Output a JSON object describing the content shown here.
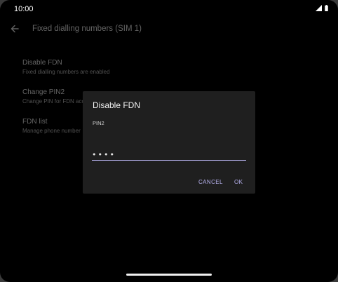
{
  "status_bar": {
    "time": "10:00"
  },
  "app_bar": {
    "title": "Fixed dialling numbers (SIM 1)"
  },
  "preferences": [
    {
      "title": "Disable FDN",
      "summary": "Fixed dialling numbers are enabled"
    },
    {
      "title": "Change PIN2",
      "summary": "Change PIN for FDN acce"
    },
    {
      "title": "FDN list",
      "summary": "Manage phone number"
    }
  ],
  "dialog": {
    "title": "Disable FDN",
    "label": "PIN2",
    "pin_value": "••••",
    "cancel_label": "CANCEL",
    "ok_label": "OK"
  },
  "icons": {
    "back": "arrow-back-icon",
    "signal": "cellular-signal-icon",
    "battery": "battery-icon"
  },
  "colors": {
    "accent": "#b9b4f2",
    "dialog_background": "#1f1f1f",
    "screen_background": "#000000"
  }
}
